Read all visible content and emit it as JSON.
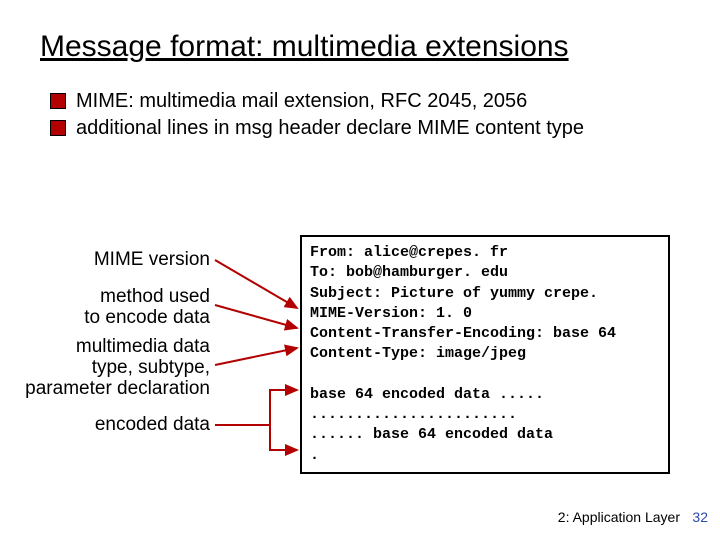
{
  "title": "Message format: multimedia extensions",
  "bullets": {
    "b1": "MIME: multimedia mail extension, RFC 2045, 2056",
    "b2": "additional lines in msg header declare MIME content type"
  },
  "labels": {
    "mime_version": "MIME version",
    "method_l1": "method used",
    "method_l2": "to encode data",
    "mdata_l1": "multimedia data",
    "mdata_l2": "type, subtype,",
    "mdata_l3": "parameter declaration",
    "encoded": "encoded data"
  },
  "mail": {
    "from": "From: alice@crepes. fr",
    "to": "To: bob@hamburger. edu",
    "subject": "Subject: Picture of yummy crepe.",
    "mime_version": "MIME-Version: 1. 0",
    "cte": "Content-Transfer-Encoding: base 64",
    "ctype": "Content-Type: image/jpeg",
    "blank": "",
    "body1": "base 64 encoded data .....",
    "body2": ".......................",
    "body3": "...... base 64 encoded data",
    "body4": "."
  },
  "footer": "2: Application Layer",
  "page_number": "32"
}
